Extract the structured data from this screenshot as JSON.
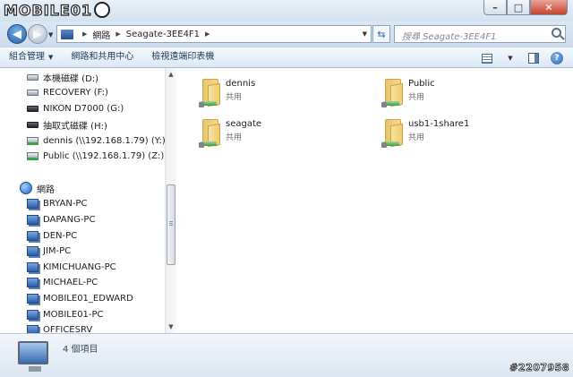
{
  "watermark": "MOBILE01",
  "post_id": "#2207958",
  "window": {
    "minimize_label": "–",
    "maximize_label": "□",
    "close_label": "✕"
  },
  "address": {
    "crumbs": [
      "網路",
      "Seagate-3EE4F1"
    ],
    "search_placeholder": "搜尋 Seagate-3EE4F1"
  },
  "commandbar": {
    "organize": "組合管理",
    "network_center": "網路和共用中心",
    "printers": "檢視遠端印表機"
  },
  "navigation": {
    "drives": [
      {
        "label": "本機磁碟 (D:)",
        "icon": "hard-drive-icon"
      },
      {
        "label": "RECOVERY (F:)",
        "icon": "hard-drive-icon"
      },
      {
        "label": "NIKON D7000 (G:)",
        "icon": "removable-drive-icon"
      },
      {
        "label": "抽取式磁碟 (H:)",
        "icon": "removable-drive-icon"
      },
      {
        "label": "dennis (\\\\192.168.1.79) (Y:)",
        "icon": "network-drive-icon"
      },
      {
        "label": "Public (\\\\192.168.1.79) (Z:)",
        "icon": "network-drive-icon"
      }
    ],
    "network_label": "網路",
    "computers": [
      "BRYAN-PC",
      "DAPANG-PC",
      "DEN-PC",
      "JIM-PC",
      "KIMICHUANG-PC",
      "MICHAEL-PC",
      "MOBILE01_EDWARD",
      "MOBILE01-PC",
      "OFFICESRV"
    ]
  },
  "shares": [
    {
      "name": "dennis",
      "type": "共用"
    },
    {
      "name": "Public",
      "type": "共用"
    },
    {
      "name": "seagate",
      "type": "共用"
    },
    {
      "name": "usb1-1share1",
      "type": "共用"
    }
  ],
  "details": {
    "item_count": "4 個項目"
  }
}
